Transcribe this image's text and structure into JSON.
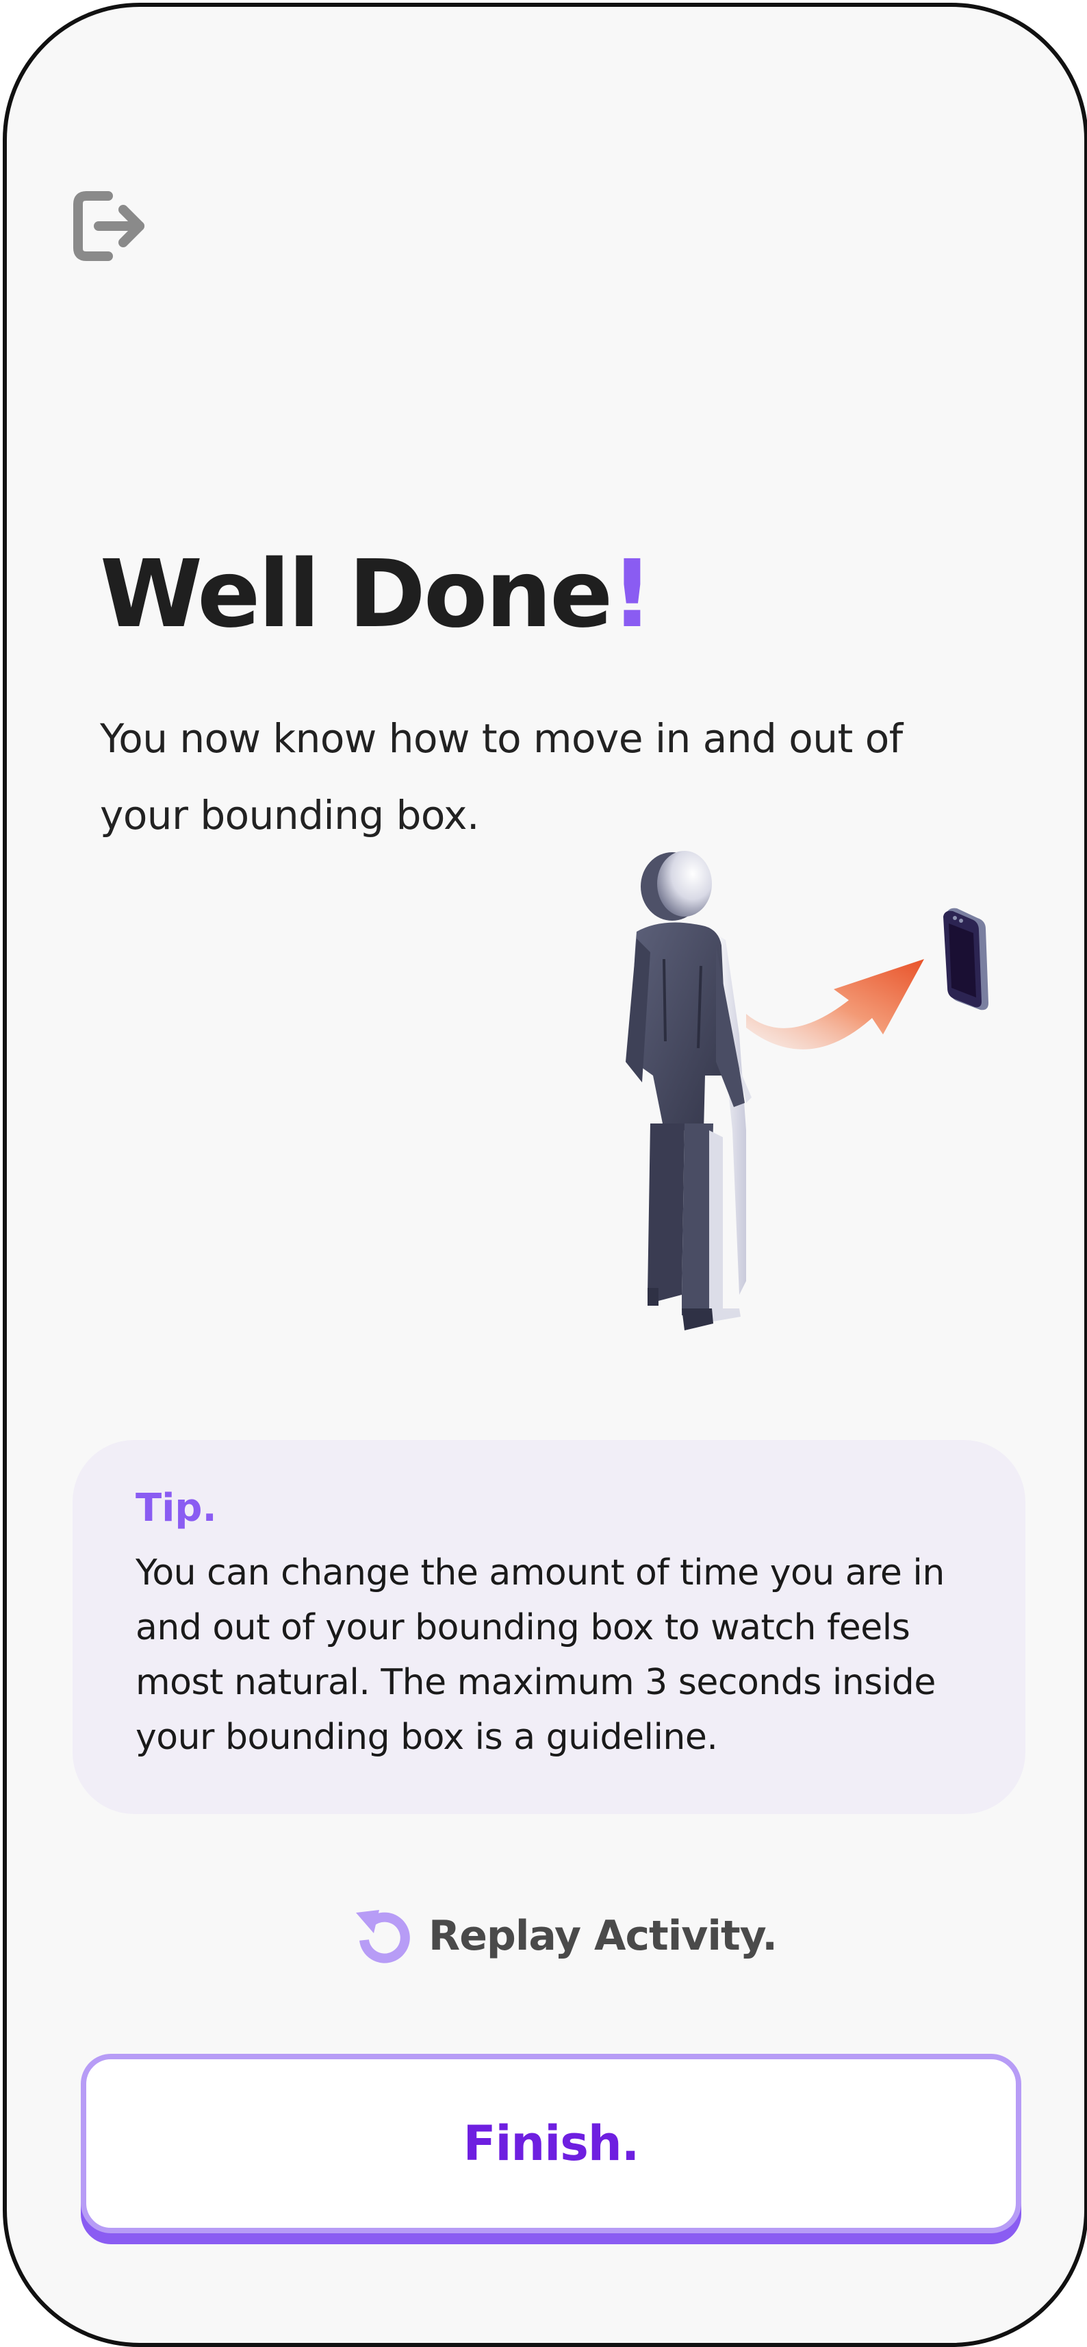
{
  "header": {
    "exit_icon": "exit-icon"
  },
  "main": {
    "title_text": "Well Done",
    "title_punct": "!",
    "subtitle": "You now know how to move in and out of your bounding box.",
    "illustration": "person-phone-illustration"
  },
  "tip": {
    "label": "Tip.",
    "text": "You can change the amount of time you are in and out of your bounding box to watch feels most natural. The maximum 3 seconds inside your bounding box is a guideline."
  },
  "actions": {
    "replay_label": "Replay Activity.",
    "replay_icon": "replay-icon",
    "finish_label": "Finish."
  },
  "colors": {
    "accent": "#8a5cf2",
    "finish_text": "#6e1fe0",
    "tip_background": "#f1eef7",
    "background": "#f8f8f8"
  }
}
